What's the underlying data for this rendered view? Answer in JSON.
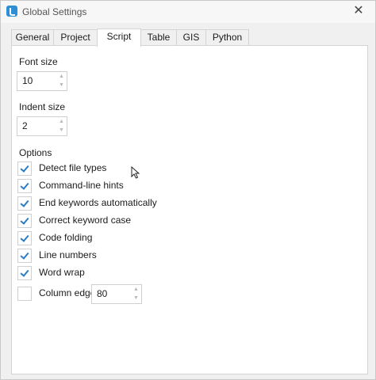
{
  "window": {
    "title": "Global Settings",
    "close_glyph": "✕",
    "icon": "app-icon"
  },
  "tabs": [
    {
      "label": "General",
      "active": false
    },
    {
      "label": "Project",
      "active": false
    },
    {
      "label": "Script",
      "active": true
    },
    {
      "label": "Table",
      "active": false
    },
    {
      "label": "GIS",
      "active": false
    },
    {
      "label": "Python",
      "active": false
    }
  ],
  "font_size": {
    "label": "Font size",
    "value": "10"
  },
  "indent_size": {
    "label": "Indent size",
    "value": "2"
  },
  "options": {
    "label": "Options",
    "items": [
      {
        "label": "Detect file types",
        "checked": true
      },
      {
        "label": "Command-line hints",
        "checked": true
      },
      {
        "label": "End keywords automatically",
        "checked": true
      },
      {
        "label": "Correct keyword case",
        "checked": true
      },
      {
        "label": "Code folding",
        "checked": true
      },
      {
        "label": "Line numbers",
        "checked": true
      },
      {
        "label": "Word wrap",
        "checked": true
      },
      {
        "label": "Column edge",
        "checked": false
      }
    ],
    "column_edge_value": "80"
  },
  "spin_glyphs": {
    "up": "▲",
    "down": "▼"
  },
  "colors": {
    "check_accent": "#2a7bc0",
    "app_icon": "#2f8fd6"
  }
}
